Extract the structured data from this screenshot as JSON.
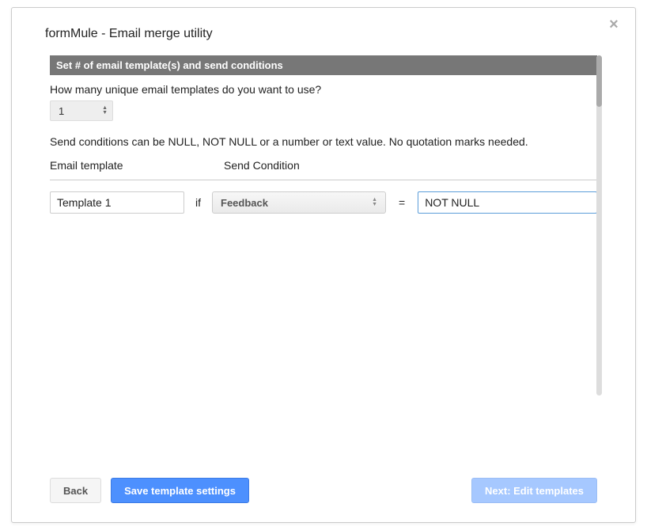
{
  "dialog": {
    "title": "formMule - Email merge utility"
  },
  "section": {
    "header": "Set # of email template(s) and send conditions",
    "question": "How many unique email templates do you want to use?",
    "template_count": "1",
    "hint": "Send conditions can be NULL, NOT NULL or a number or text value. No quotation marks needed.",
    "col_email_template": "Email template",
    "col_send_condition": "Send Condition"
  },
  "row": {
    "template_name": "Template 1",
    "if_label": "if",
    "condition_field": "Feedback",
    "eq_label": "=",
    "condition_value": "NOT NULL"
  },
  "buttons": {
    "back": "Back",
    "save": "Save template settings",
    "next": "Next: Edit templates"
  }
}
